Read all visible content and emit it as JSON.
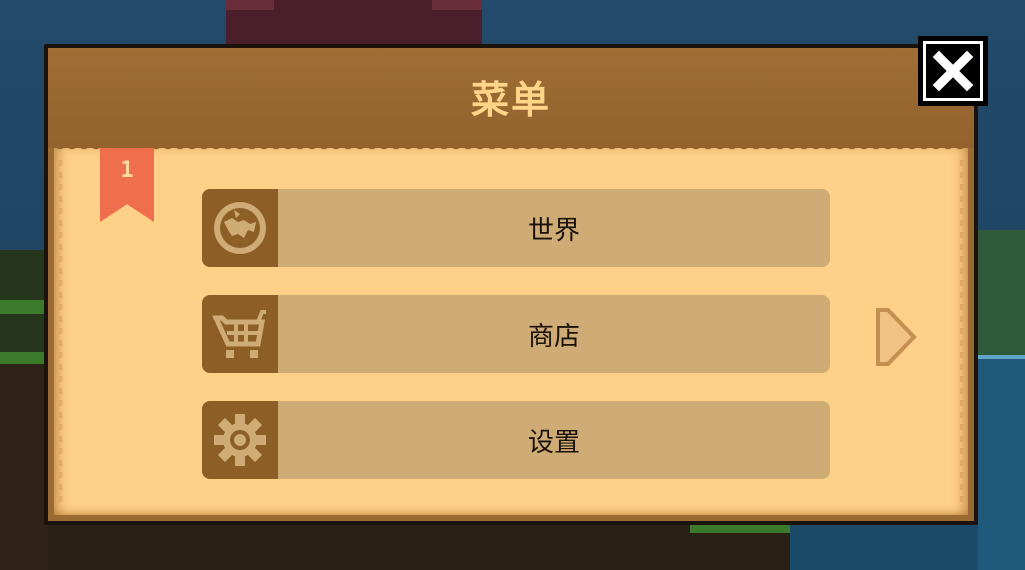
{
  "dialog": {
    "title": "菜单",
    "page_number": "1"
  },
  "menu": {
    "items": [
      {
        "label": "世界",
        "icon": "globe-icon"
      },
      {
        "label": "商店",
        "icon": "shopping-cart-icon"
      },
      {
        "label": "设置",
        "icon": "gear-icon"
      }
    ]
  },
  "controls": {
    "close_icon": "close-icon",
    "next_icon": "next-page-arrow-icon"
  },
  "colors": {
    "header": "#93622d",
    "title_text": "#ffd58a",
    "paper": "#ffd088",
    "button": "#cfab75",
    "icon_box": "#8e5e27",
    "bookmark": "#ef6e4c"
  }
}
